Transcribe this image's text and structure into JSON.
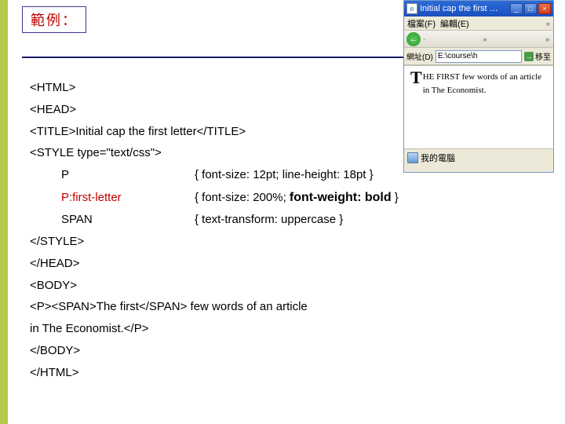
{
  "header": {
    "example_label": "範例："
  },
  "code": {
    "l1": "<HTML>",
    "l2": "<HEAD>",
    "l3": "<TITLE>Initial cap the first letter</TITLE>",
    "l4": "<STYLE type=\"text/css\">",
    "r1_sel": "P",
    "r1_rule": "{ font-size: 12pt; line-height: 18pt }",
    "r2_sel": "P:first-letter",
    "r2_rule_a": "{ font-size: 200%; ",
    "r2_rule_b": "font-weight: bold",
    "r2_rule_c": " }",
    "r3_sel": "SPAN",
    "r3_rule": "{ text-transform: uppercase }",
    "l5": "</STYLE>",
    "l6": "</HEAD>",
    "l7": "<BODY>",
    "l8": "<P><SPAN>The first</SPAN> few words of an article",
    "l9": "in The Economist.</P>",
    "l10": "</BODY>",
    "l11": "</HTML>"
  },
  "preview": {
    "title": "Initial cap the first …",
    "menu_file": "檔案(F)",
    "menu_edit": "編輯(E)",
    "menu_chevron": "»",
    "toolbar_chevron": "»",
    "addr_label": "網址(D)",
    "addr_value": "E:\\course\\h",
    "go_label": "移至",
    "content_firstcap": "T",
    "content_caps": "HE FIRST",
    "content_rest": " few words of an article in The Economist.",
    "status_label": "我的電腦"
  }
}
